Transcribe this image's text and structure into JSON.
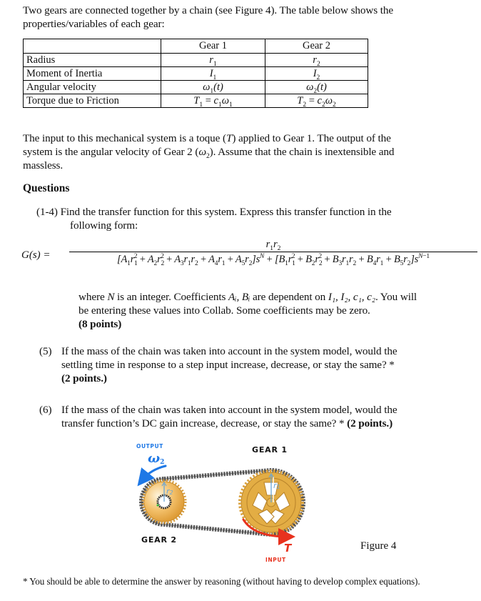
{
  "intro": {
    "line1": "Two gears are connected together by a chain (see Figure 4). The table below shows the",
    "line2": "properties/variables of each gear:"
  },
  "table": {
    "headers": [
      "",
      "Gear 1",
      "Gear 2"
    ],
    "rows": [
      {
        "label": "Radius",
        "gear1": {
          "base": "r",
          "sub": "1"
        },
        "gear2": {
          "base": "r",
          "sub": "2"
        }
      },
      {
        "label": "Moment of Inertia",
        "gear1": {
          "base": "I",
          "sub": "1"
        },
        "gear2": {
          "base": "I",
          "sub": "2"
        }
      },
      {
        "label": "Angular velocity",
        "gear1": {
          "base": "ω",
          "sub": "1",
          "tail": "(t)"
        },
        "gear2": {
          "base": "ω",
          "sub": "2",
          "tail": "(t)"
        }
      },
      {
        "label": "Torque due to Friction",
        "gear1": {
          "lhs": "T",
          "sub": "1",
          "eq": " = ",
          "c": "c",
          "csub": "1",
          "w": "ω",
          "wsub": "1"
        },
        "gear2": {
          "lhs": "T",
          "sub": "2",
          "eq": " = ",
          "c": "c",
          "csub": "2",
          "w": "ω",
          "wsub": "2"
        }
      }
    ]
  },
  "system": {
    "line1_a": "The input to this mechanical system is a toque (",
    "line1_sym": "T",
    "line1_b": ") applied to Gear 1. The output of the",
    "line2_a": "system is the angular velocity of Gear 2 (",
    "line2_sym": "ω",
    "line2_sub": "2",
    "line2_b": "). Assume that the chain is inextensible and",
    "line3": "massless."
  },
  "questions_heading": "Questions",
  "q1": {
    "number": "(1-4)",
    "line1": "Find the transfer function for this system. Express this transfer function in the",
    "line2": "following form:"
  },
  "equation": {
    "lhs": "G(s) =",
    "numerator": "r₁r₂",
    "denominator": "[A₁r₁² + A₂r₂² + A₃r₁r₂ + A₄r₁ + A₅r₂]s^N + [B₁r₁² + B₂r₂² + B₃r₁r₂ + B₄r₁ + B₅r₂]s^(N−1)"
  },
  "q1_notes": {
    "line1_a": "where ",
    "line1_N": "N",
    "line1_b": " is an integer. Coefficients ",
    "line1_coef": "Aᵢ, Bᵢ",
    "line1_c": " are dependent on ",
    "line1_deps": "I₁, I₂, c₁, c₂",
    "line1_d": ". You will",
    "line2": "be entering these values into Collab. Some coefficients may be zero.",
    "points": "(8 points)"
  },
  "q5": {
    "number": "(5)",
    "line1": "If the mass of the chain was taken into account in the system model, would the",
    "line2": "settling time in response to a step input increase, decrease, or stay the same? *",
    "points": "(2 points.)"
  },
  "q6": {
    "number": "(6)",
    "line1": "If the mass of the chain was taken into account in the system model, would the",
    "line2": "transfer function’s DC gain increase, decrease, or stay the same? *",
    "points": "(2 points.)"
  },
  "figure": {
    "output_label": "OUTPUT",
    "omega_label": "ω",
    "omega_sub": "2",
    "gear1_label": "GEAR 1",
    "gear2_label": "GEAR 2",
    "r1_label": "r",
    "r1_sub": "1",
    "r2_label": "r",
    "r2_sub": "2",
    "torque_label": "T",
    "input_label": "INPUT",
    "caption": "Figure 4",
    "colors": {
      "output": "#1e78e6",
      "input": "#e8321e",
      "gear_gold": "#e0a93a",
      "chain": "#4a4a4a",
      "radius_arrow": "#6aa6d6"
    }
  },
  "footnote": "* You should be able to determine the answer by reasoning (without having to develop complex equations)."
}
